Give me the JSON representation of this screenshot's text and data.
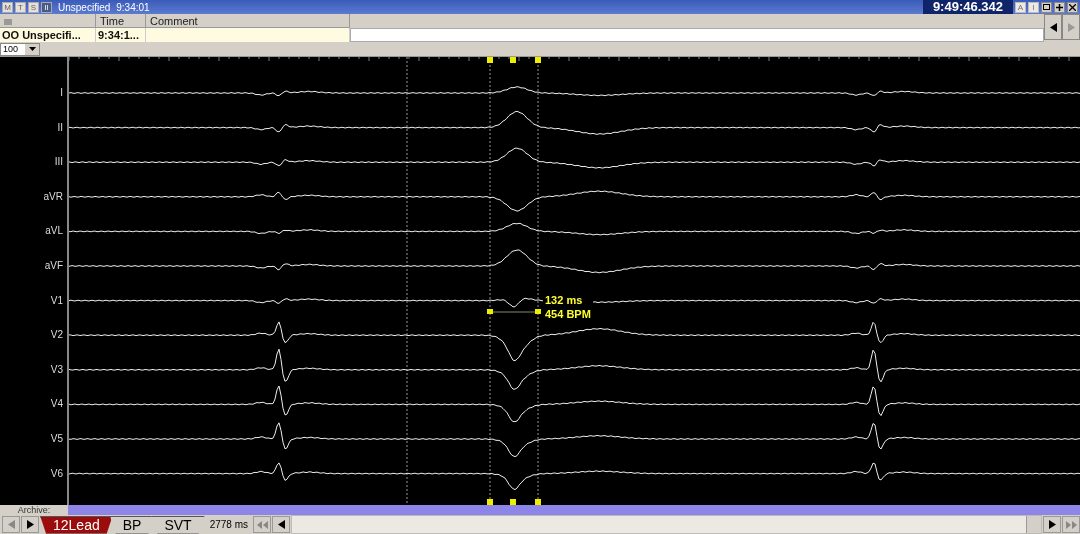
{
  "title_bar": {
    "mode_buttons": [
      {
        "label": "M",
        "selected": false
      },
      {
        "label": "T",
        "selected": false
      },
      {
        "label": "S",
        "selected": false
      },
      {
        "label": "II",
        "selected": true
      }
    ],
    "episode": "Unspecified",
    "time": "9:34:01",
    "clock": "9:49:46.342",
    "view_buttons": [
      {
        "label": "A",
        "disabled": true
      },
      {
        "label": "I",
        "disabled": true
      }
    ]
  },
  "event_table": {
    "columns": [
      "Time",
      "Comment"
    ],
    "rows": [
      {
        "name": "OO Unspecifi...",
        "time": "9:34:1..."
      }
    ]
  },
  "gain": {
    "value": "100"
  },
  "leads": [
    {
      "label": "I"
    },
    {
      "label": "II"
    },
    {
      "label": "III"
    },
    {
      "label": "aVR"
    },
    {
      "label": "aVL"
    },
    {
      "label": "aVF"
    },
    {
      "label": "V1"
    },
    {
      "label": "V2"
    },
    {
      "label": "V3"
    },
    {
      "label": "V4"
    },
    {
      "label": "V5"
    },
    {
      "label": "V6"
    }
  ],
  "measurement": {
    "interval": "132 ms",
    "rate": "454 BPM"
  },
  "archive_label": "Archive:",
  "tabs": [
    {
      "label": "12Lead",
      "selected": true
    },
    {
      "label": "BP",
      "selected": false
    },
    {
      "label": "SVT",
      "selected": false
    }
  ],
  "duration": "2778 ms"
}
